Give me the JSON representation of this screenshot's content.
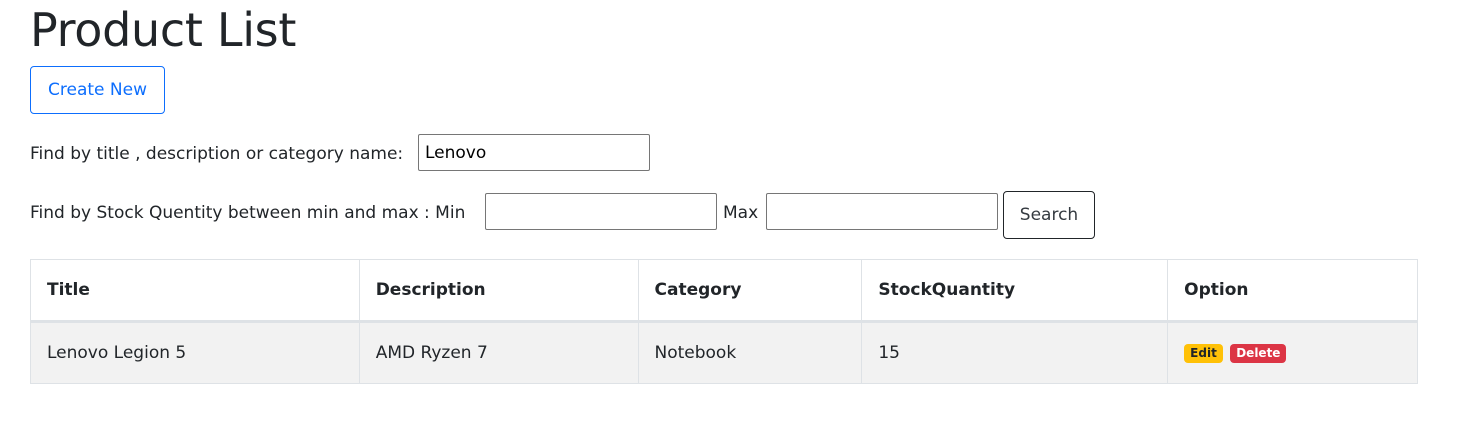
{
  "page": {
    "title": "Product List"
  },
  "actions": {
    "create_label": "Create New"
  },
  "filters": {
    "text_label": "Find by title , description or category name:",
    "text_value": "Lenovo",
    "stock_label": "Find by Stock Quentity between min and max : Min",
    "max_label": "Max",
    "min_value": "",
    "max_value": "",
    "search_label": "Search"
  },
  "table": {
    "columns": [
      "Title",
      "Description",
      "Category",
      "StockQuantity",
      "Option"
    ],
    "rows": [
      {
        "title": "Lenovo Legion 5",
        "description": "AMD Ryzen 7",
        "category": "Notebook",
        "stock_quantity": "15",
        "edit_label": "Edit",
        "delete_label": "Delete"
      }
    ]
  },
  "colors": {
    "primary": "#0d6efd",
    "warning": "#ffc107",
    "danger": "#dc3545",
    "row_stripe": "#f2f2f2"
  }
}
